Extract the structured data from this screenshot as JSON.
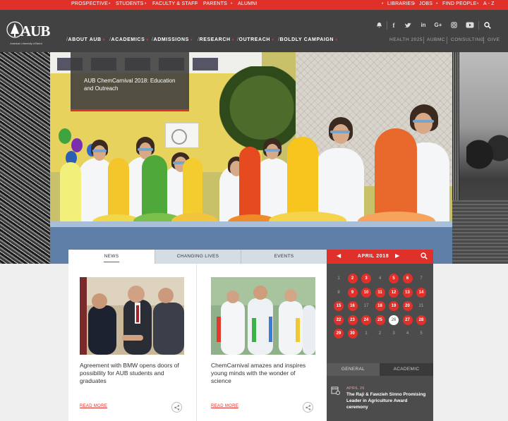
{
  "top_links": [
    "PROSPECTIVE",
    "STUDENTS",
    "FACULTY & STAFF",
    "PARENTS",
    "ALUMNI"
  ],
  "util_links": [
    "LIBRARIES",
    "JOBS",
    "FIND PEOPLE",
    "A - Z"
  ],
  "logo": {
    "text": "AUB",
    "subtitle": "American University of Beirut"
  },
  "nav": [
    "ABOUT AUB",
    "ACADEMICS",
    "ADMISSIONS",
    "RESEARCH",
    "OUTREACH",
    "BOLDLY CAMPAIGN"
  ],
  "social_icons": [
    "notification-icon",
    "facebook-icon",
    "twitter-icon",
    "linkedin-icon",
    "google-plus-icon",
    "instagram-icon",
    "youtube-icon",
    "search-icon"
  ],
  "secondary_links": [
    "HEALTH 2025",
    "AUBMC",
    "CONSULTING",
    "GIVE"
  ],
  "hero": {
    "caption": "AUB ChemCarnival 2018: Education and Outreach"
  },
  "tabs": [
    "NEWS",
    "CHANGING LIVES",
    "EVENTS"
  ],
  "news": [
    {
      "title": "Agreement with BMW opens doors of possibility for AUB students and graduates",
      "more": "READ MORE"
    },
    {
      "title": "ChemCarnival amazes and inspires young minds with the wonder of science",
      "more": "READ MORE"
    }
  ],
  "calendar": {
    "month": "APRIL 2018",
    "weeks": [
      [
        "1",
        "2",
        "3",
        "4",
        "5",
        "6",
        "7"
      ],
      [
        "8",
        "9",
        "10",
        "11",
        "12",
        "13",
        "14"
      ],
      [
        "15",
        "16",
        "17",
        "18",
        "19",
        "20",
        "21"
      ],
      [
        "22",
        "23",
        "24",
        "25",
        "26",
        "27",
        "28"
      ],
      [
        "29",
        "30",
        "1",
        "2",
        "3",
        "4",
        "5"
      ]
    ],
    "event_days": [
      "2",
      "3",
      "5",
      "6",
      "9",
      "10",
      "11",
      "12",
      "13",
      "14",
      "15",
      "16",
      "18",
      "19",
      "20",
      "22",
      "23",
      "24",
      "25",
      "27",
      "28",
      "29",
      "30"
    ],
    "today": "26",
    "colors": {
      "event": "#e0302a",
      "today": "#ffffff"
    }
  },
  "event_tabs": [
    "GENERAL",
    "ACADEMIC"
  ],
  "events": [
    {
      "date": "APRIL 26",
      "title": "The Raji & Fawzieh Sinno Promising Leader in Agriculture Award ceremony"
    }
  ],
  "colors": {
    "brand_red": "#e0302a",
    "header_bg": "#424242",
    "panel_bg": "#4c4c4c"
  }
}
